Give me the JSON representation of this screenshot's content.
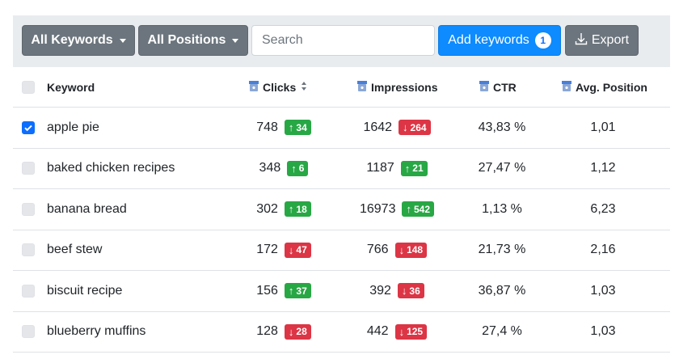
{
  "toolbar": {
    "keywords_filter": "All Keywords",
    "positions_filter": "All Positions",
    "search_placeholder": "Search",
    "add_keywords_label": "Add keywords",
    "add_keywords_count": "1",
    "export_label": "Export"
  },
  "columns": {
    "keyword": "Keyword",
    "clicks": "Clicks",
    "impressions": "Impressions",
    "ctr": "CTR",
    "avg_position": "Avg. Position"
  },
  "rows": [
    {
      "checked": true,
      "keyword": "apple pie",
      "clicks": "748",
      "clicks_delta": "34",
      "clicks_dir": "up",
      "impressions": "1642",
      "impressions_delta": "264",
      "impressions_dir": "down",
      "ctr": "43,83 %",
      "avg_position": "1,01"
    },
    {
      "checked": false,
      "keyword": "baked chicken recipes",
      "clicks": "348",
      "clicks_delta": "6",
      "clicks_dir": "up",
      "impressions": "1187",
      "impressions_delta": "21",
      "impressions_dir": "up",
      "ctr": "27,47 %",
      "avg_position": "1,12"
    },
    {
      "checked": false,
      "keyword": "banana bread",
      "clicks": "302",
      "clicks_delta": "18",
      "clicks_dir": "up",
      "impressions": "16973",
      "impressions_delta": "542",
      "impressions_dir": "up",
      "ctr": "1,13 %",
      "avg_position": "6,23"
    },
    {
      "checked": false,
      "keyword": "beef stew",
      "clicks": "172",
      "clicks_delta": "47",
      "clicks_dir": "down",
      "impressions": "766",
      "impressions_delta": "148",
      "impressions_dir": "down",
      "ctr": "21,73 %",
      "avg_position": "2,16"
    },
    {
      "checked": false,
      "keyword": "biscuit recipe",
      "clicks": "156",
      "clicks_delta": "37",
      "clicks_dir": "up",
      "impressions": "392",
      "impressions_delta": "36",
      "impressions_dir": "down",
      "ctr": "36,87 %",
      "avg_position": "1,03"
    },
    {
      "checked": false,
      "keyword": "blueberry muffins",
      "clicks": "128",
      "clicks_delta": "28",
      "clicks_dir": "down",
      "impressions": "442",
      "impressions_delta": "125",
      "impressions_dir": "down",
      "ctr": "27,4 %",
      "avg_position": "1,03"
    }
  ],
  "colors": {
    "up": "#28a745",
    "down": "#dc3545",
    "primary": "#0d8bff",
    "secondary": "#6c757d"
  },
  "icons": {
    "google_column_icon": "google-lock-icon",
    "sort_icon": "sort-icon",
    "export_icon": "download-icon"
  }
}
